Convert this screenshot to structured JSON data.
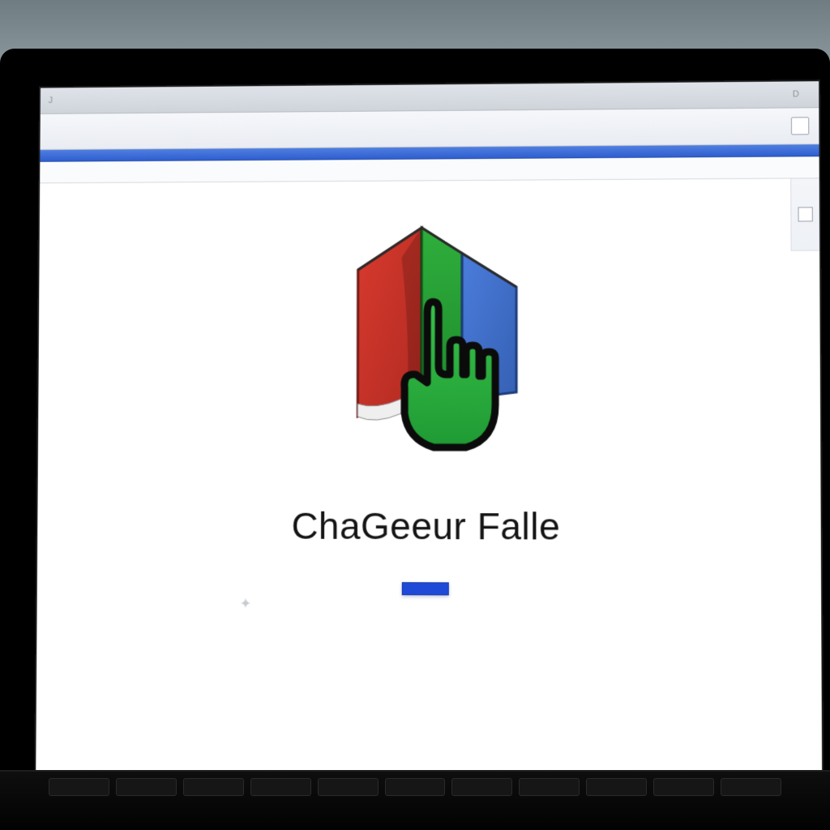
{
  "titlebar": {
    "seg1": "J",
    "seg2": "",
    "seg3": "",
    "right1": "D",
    "right2": ""
  },
  "toolbar": {
    "seg1": "",
    "seg2": "",
    "right_label": ""
  },
  "subbar": {
    "label": ""
  },
  "hero": {
    "brand": "ChaGeeur Falle",
    "cta_label": ""
  }
}
